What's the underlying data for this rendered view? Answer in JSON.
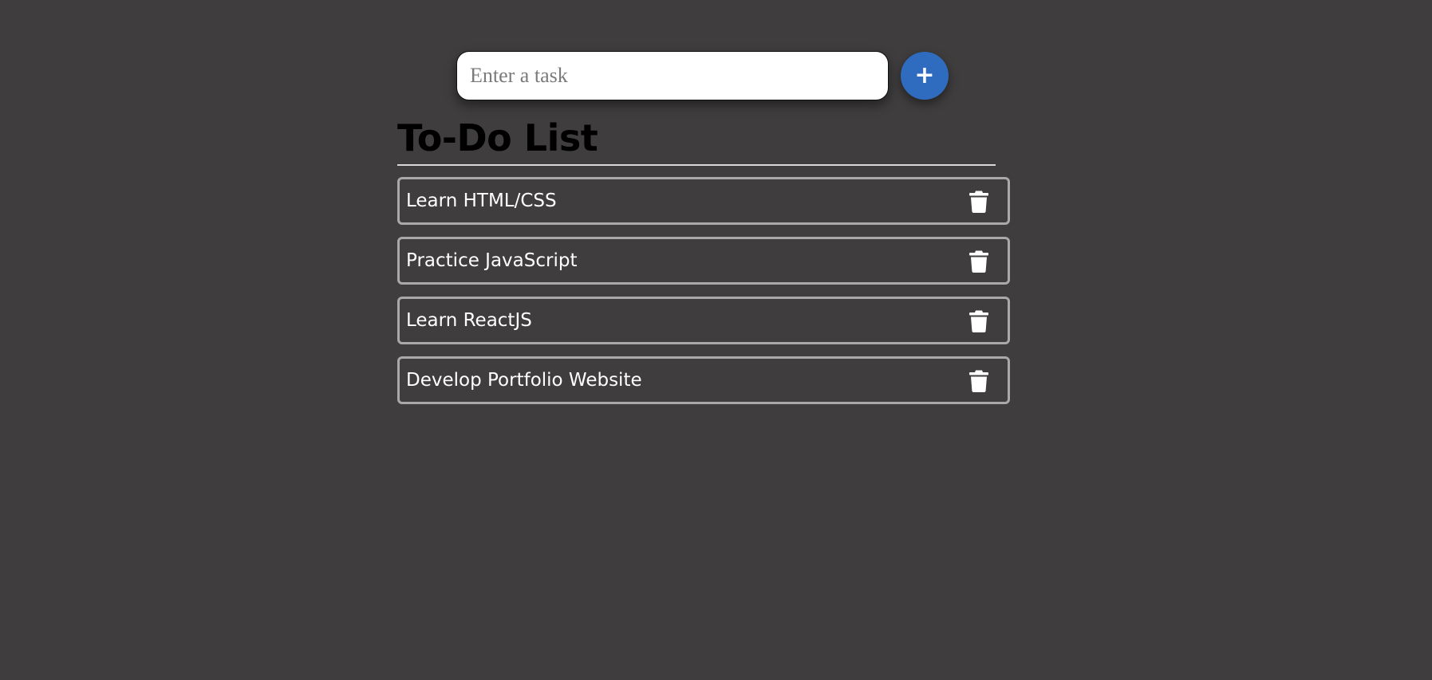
{
  "input": {
    "placeholder": "Enter a task",
    "value": ""
  },
  "add_button": {
    "label": "+",
    "color": "#2f6cc0"
  },
  "list": {
    "title": "To-Do List",
    "items": [
      {
        "label": "Learn HTML/CSS",
        "action_icon": "trash-icon"
      },
      {
        "label": "Practice JavaScript",
        "action_icon": "trash-icon"
      },
      {
        "label": "Learn ReactJS",
        "action_icon": "trash-icon"
      },
      {
        "label": "Develop Portfolio Website",
        "action_icon": "trash-icon"
      }
    ]
  },
  "colors": {
    "background": "#3f3d3e",
    "item_border": "#a9a9a9",
    "title": "#000000",
    "text": "#ffffff"
  }
}
